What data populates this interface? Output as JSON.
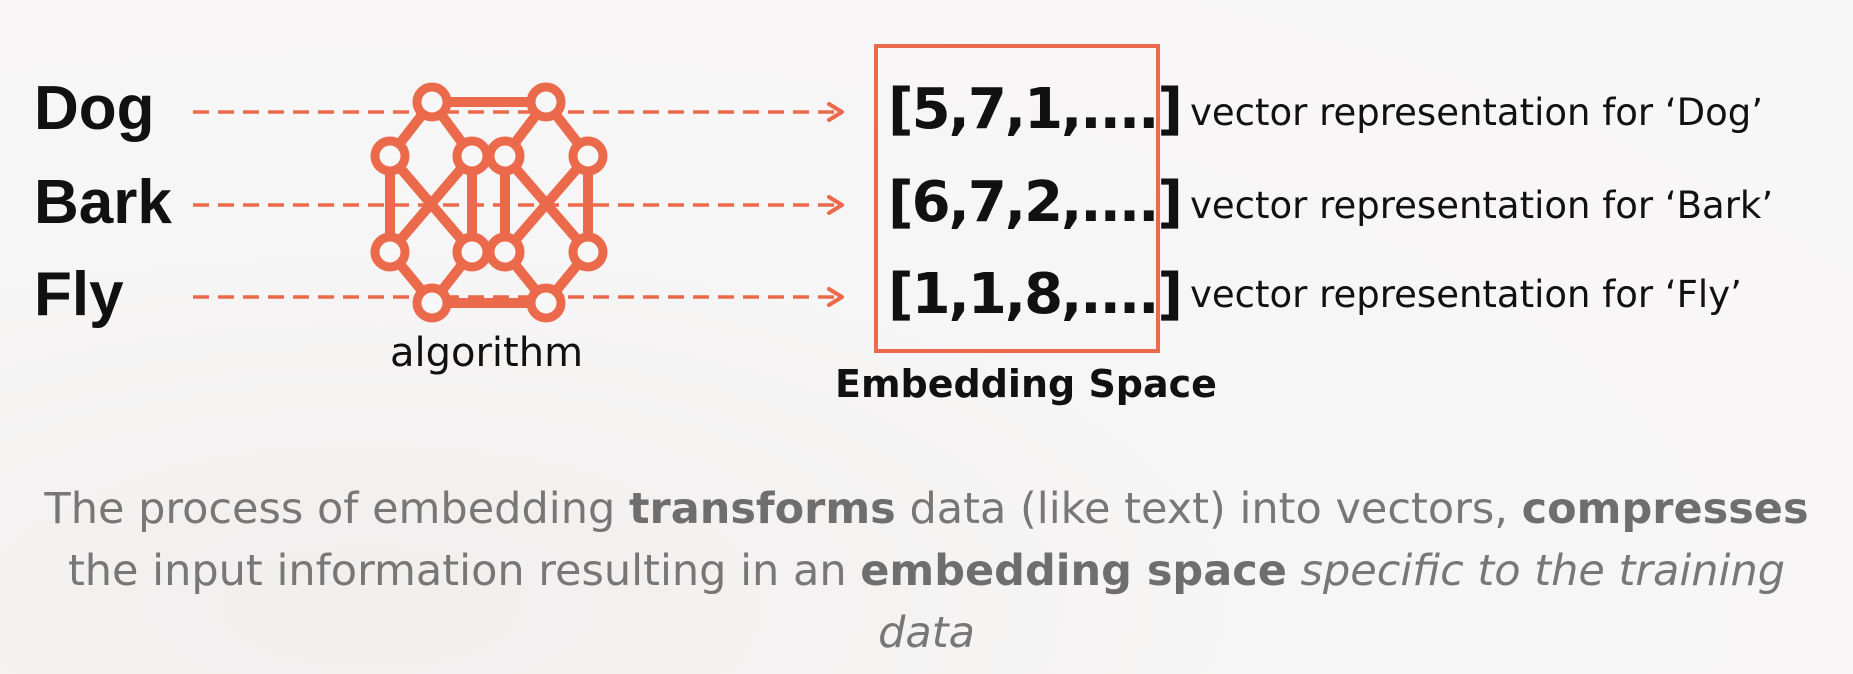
{
  "words": [
    "Dog",
    "Bark",
    "Fly"
  ],
  "vectors": [
    "[5,7,1,....]",
    "[6,7,2,....]",
    "[1,1,8,....]"
  ],
  "descriptions": [
    "vector representation for ‘Dog’",
    "vector representation for ‘Bark’",
    "vector representation for ‘Fly’"
  ],
  "algorithm_label": "algorithm",
  "embedding_space_label": "Embedding Space",
  "caption": {
    "t1": "The process of embedding ",
    "b1": "transforms",
    "t2": " data (like text) into vectors, ",
    "b2": "compresses",
    "t3": " the input information resulting in an ",
    "b3": "embedding space",
    "t4": " ",
    "i1": "specific to the training data"
  },
  "colors": {
    "accent": "#ec6a4c",
    "text": "#111111",
    "caption": "#777777"
  },
  "icons": {
    "algorithm": "neural-network-icon"
  }
}
